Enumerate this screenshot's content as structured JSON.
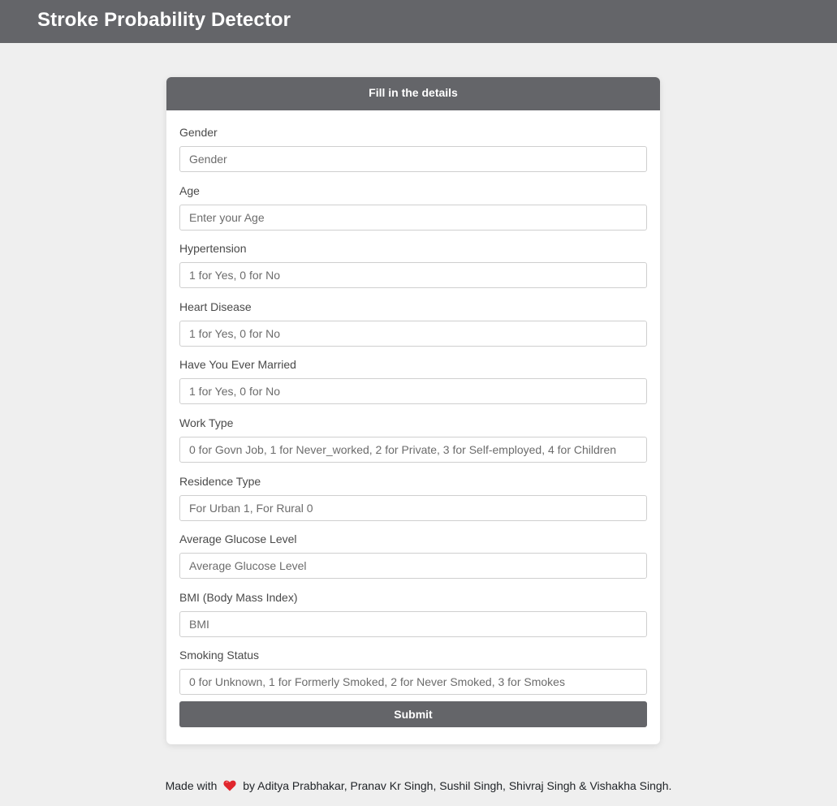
{
  "header": {
    "brand": "Stroke Probability Detector"
  },
  "form": {
    "title": "Fill in the details",
    "fields": [
      {
        "label": "Gender",
        "placeholder": "Gender",
        "value": ""
      },
      {
        "label": "Age",
        "placeholder": "Enter your Age",
        "value": ""
      },
      {
        "label": "Hypertension",
        "placeholder": "1 for Yes, 0 for No",
        "value": ""
      },
      {
        "label": "Heart Disease",
        "placeholder": "1 for Yes, 0 for No",
        "value": ""
      },
      {
        "label": "Have You Ever Married",
        "placeholder": "1 for Yes, 0 for No",
        "value": ""
      },
      {
        "label": "Work Type",
        "placeholder": "0 for Govn Job, 1 for Never_worked, 2 for Private, 3 for Self-employed, 4 for Children",
        "value": ""
      },
      {
        "label": "Residence Type",
        "placeholder": "For Urban 1, For Rural 0",
        "value": ""
      },
      {
        "label": "Average Glucose Level",
        "placeholder": "Average Glucose Level",
        "value": ""
      },
      {
        "label": "BMI (Body Mass Index)",
        "placeholder": "BMI",
        "value": ""
      },
      {
        "label": "Smoking Status",
        "placeholder": "0 for Unknown, 1 for Formerly Smoked, 2 for Never Smoked, 3 for Smokes",
        "value": ""
      }
    ],
    "submit_label": "Submit"
  },
  "footer": {
    "prefix": "Made with",
    "icon": "heart-icon",
    "suffix": "by Aditya Prabhakar, Pranav Kr Singh, Sushil Singh, Shivraj Singh & Vishakha Singh."
  },
  "colors": {
    "header_bg": "#646569",
    "page_bg": "#efefef",
    "heart": "#e0262d"
  }
}
